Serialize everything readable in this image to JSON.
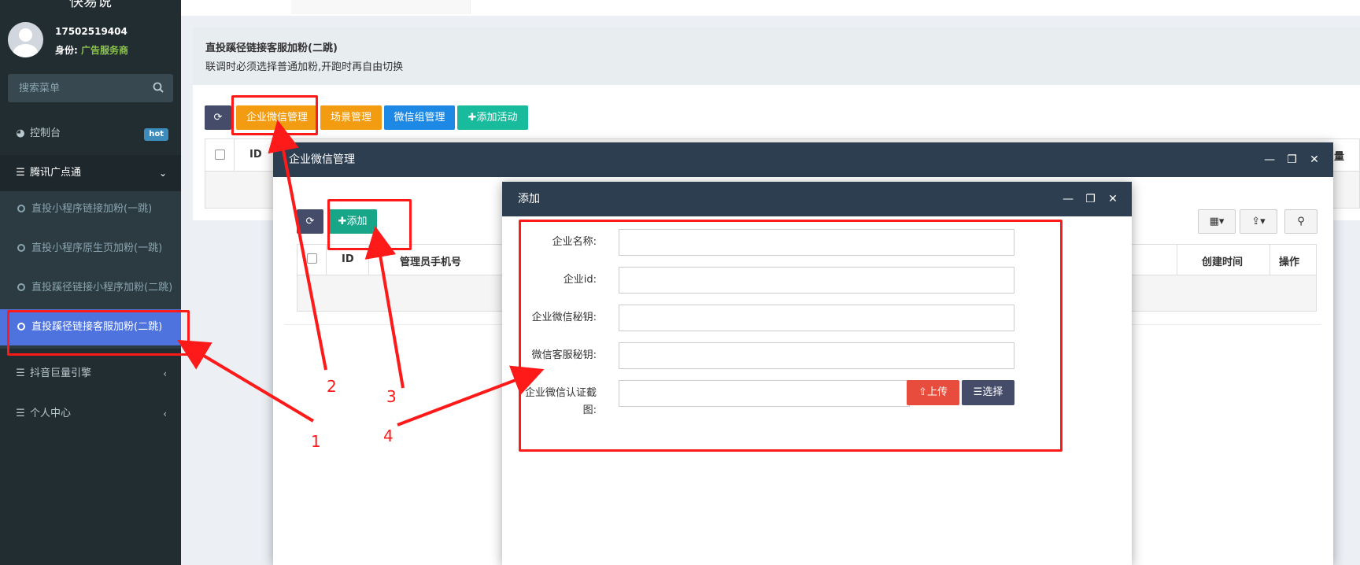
{
  "sidebar": {
    "brand": "快易说",
    "user": {
      "phone": "17502519404",
      "role_label": "身份:",
      "role_value": "广告服务商"
    },
    "search_placeholder": "搜索菜单",
    "items": [
      {
        "label": "控制台",
        "badge": "hot"
      },
      {
        "label": "腾讯广点通"
      },
      {
        "label": "抖音巨量引擎"
      },
      {
        "label": "个人中心"
      }
    ],
    "subitems": [
      {
        "label": "直投小程序链接加粉(一跳)"
      },
      {
        "label": "直投小程序原生页加粉(一跳)"
      },
      {
        "label": "直投蹊径链接小程序加粉(二跳)"
      },
      {
        "label": "直投蹊径链接客服加粉(二跳)"
      }
    ]
  },
  "panel": {
    "title": "直投蹊径链接客服加粉(二跳)",
    "desc": "联调时必须选择普通加粉,开跑时再自由切换"
  },
  "toolbar": {
    "corp_wechat": "企业微信管理",
    "scene": "场景管理",
    "wechat_group": "微信组管理",
    "add_activity": "添加活动"
  },
  "bg_table": {
    "id_header": "ID",
    "right_header": "量"
  },
  "layer1": {
    "title": "企业微信管理",
    "add_label": "添加",
    "headers": {
      "id": "ID",
      "admin_phone": "管理员手机号",
      "created": "创建时间",
      "ops": "操作"
    }
  },
  "layer2": {
    "title": "添加",
    "fields": [
      {
        "label": "企业名称:",
        "value": ""
      },
      {
        "label": "企业id:",
        "value": ""
      },
      {
        "label": "企业微信秘钥:",
        "value": ""
      },
      {
        "label": "微信客服秘钥:",
        "value": ""
      }
    ],
    "cert_label": "企业微信认证截图:",
    "upload": "上传",
    "choose": "选择"
  },
  "annotations": [
    "1",
    "2",
    "3",
    "4"
  ],
  "colors": {
    "annotation": "#ff1a1a",
    "sidebar_bg": "#222d32",
    "active_item": "#4e73df",
    "layer_head": "#2c3e50"
  }
}
